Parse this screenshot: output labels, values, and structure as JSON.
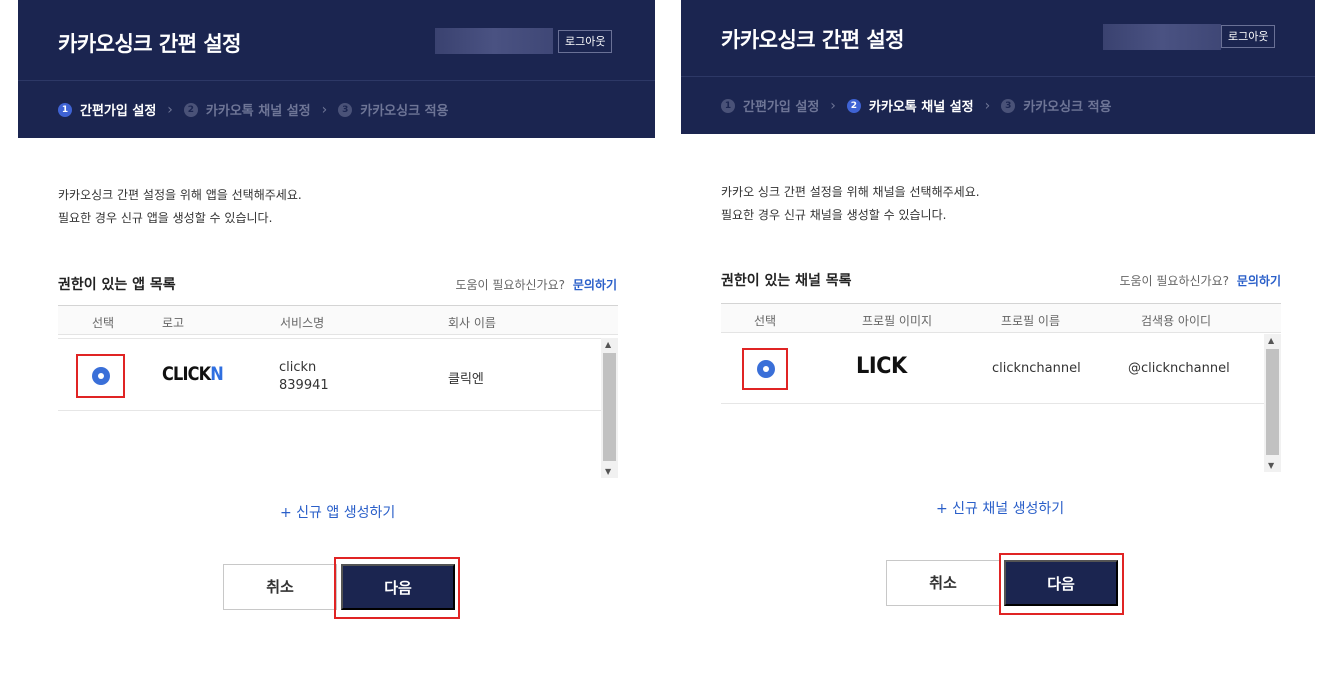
{
  "panels": [
    {
      "title": "카카오싱크 간편 설정",
      "logout_label": "로그아웃",
      "steps": [
        {
          "num": "1",
          "label": "간편가입 설정"
        },
        {
          "num": "2",
          "label": "카카오톡 채널 설정"
        },
        {
          "num": "3",
          "label": "카카오싱크 적용"
        }
      ],
      "active_step": 1,
      "intro_lines": [
        "카카오싱크 간편 설정을 위해 앱을 선택해주세요.",
        "필요한 경우 신규 앱을 생성할 수 있습니다."
      ],
      "list_title": "권한이 있는 앱 목록",
      "help_text": "도움이 필요하신가요?",
      "help_link": "문의하기",
      "columns": [
        "선택",
        "로고",
        "서비스명",
        "회사 이름"
      ],
      "row": {
        "logo_text": "CLICK",
        "logo_accent": "N",
        "service_name": "clickn",
        "service_id": "839941",
        "company": "클릭엔",
        "selected": true
      },
      "new_link": "+ 신규 앱 생성하기",
      "cancel_label": "취소",
      "next_label": "다음"
    },
    {
      "title": "카카오싱크 간편 설정",
      "logout_label": "로그아웃",
      "steps": [
        {
          "num": "1",
          "label": "간편가입 설정"
        },
        {
          "num": "2",
          "label": "카카오톡 채널 설정"
        },
        {
          "num": "3",
          "label": "카카오싱크 적용"
        }
      ],
      "active_step": 2,
      "intro_lines": [
        "카카오 싱크 간편 설정을 위해 채널을 선택해주세요.",
        "필요한 경우 신규 채널을 생성할 수 있습니다."
      ],
      "list_title": "권한이 있는 채널 목록",
      "help_text": "도움이 필요하신가요?",
      "help_link": "문의하기",
      "columns": [
        "선택",
        "프로필 이미지",
        "프로필 이름",
        "검색용 아이디"
      ],
      "row": {
        "profile_image_text": "LICK",
        "profile_name": "clicknchannel",
        "search_id": "@clicknchannel",
        "selected": true
      },
      "new_link": "+ 신규 채널 생성하기",
      "cancel_label": "취소",
      "next_label": "다음"
    }
  ],
  "colors": {
    "header_bg": "#1b2550",
    "accent_blue": "#3a6fd8",
    "link_blue": "#2a5fc9",
    "highlight_red": "#e02424"
  },
  "icons": [
    "radio-selected-icon",
    "chevron-right-icon",
    "scroll-up-icon",
    "scroll-down-icon"
  ]
}
